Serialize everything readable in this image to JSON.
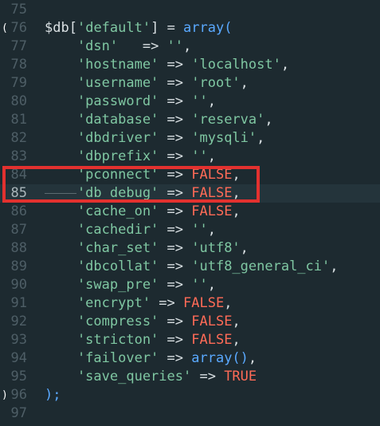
{
  "lines": [
    {
      "n": "75",
      "parts": []
    },
    {
      "n": "76",
      "fold": "(",
      "parts": [
        {
          "cls": "var",
          "t": "$db"
        },
        {
          "cls": "p",
          "t": "["
        },
        {
          "cls": "k",
          "t": "'default'"
        },
        {
          "cls": "p",
          "t": "] = "
        },
        {
          "cls": "fn",
          "t": "array("
        }
      ]
    },
    {
      "n": "77",
      "parts": [
        {
          "cls": "k",
          "t": "    'dsn'"
        },
        {
          "cls": "p",
          "t": "   => "
        },
        {
          "cls": "v",
          "t": "''"
        },
        {
          "cls": "p",
          "t": ","
        }
      ]
    },
    {
      "n": "78",
      "parts": [
        {
          "cls": "k",
          "t": "    'hostname'"
        },
        {
          "cls": "p",
          "t": " => "
        },
        {
          "cls": "v",
          "t": "'localhost'"
        },
        {
          "cls": "p",
          "t": ","
        }
      ]
    },
    {
      "n": "79",
      "parts": [
        {
          "cls": "k",
          "t": "    'username'"
        },
        {
          "cls": "p",
          "t": " => "
        },
        {
          "cls": "v",
          "t": "'root'"
        },
        {
          "cls": "p",
          "t": ","
        }
      ]
    },
    {
      "n": "80",
      "parts": [
        {
          "cls": "k",
          "t": "    'password'"
        },
        {
          "cls": "p",
          "t": " => "
        },
        {
          "cls": "v",
          "t": "''"
        },
        {
          "cls": "p",
          "t": ","
        }
      ]
    },
    {
      "n": "81",
      "parts": [
        {
          "cls": "k",
          "t": "    'database'"
        },
        {
          "cls": "p",
          "t": " => "
        },
        {
          "cls": "v",
          "t": "'reserva'"
        },
        {
          "cls": "p",
          "t": ","
        }
      ]
    },
    {
      "n": "82",
      "parts": [
        {
          "cls": "k",
          "t": "    'dbdriver'"
        },
        {
          "cls": "p",
          "t": " => "
        },
        {
          "cls": "v",
          "t": "'mysqli'"
        },
        {
          "cls": "p",
          "t": ","
        }
      ]
    },
    {
      "n": "83",
      "parts": [
        {
          "cls": "k",
          "t": "    'dbprefix'"
        },
        {
          "cls": "p",
          "t": " => "
        },
        {
          "cls": "v",
          "t": "''"
        },
        {
          "cls": "p",
          "t": ","
        }
      ]
    },
    {
      "n": "84",
      "parts": [
        {
          "cls": "k",
          "t": "    'pconnect'"
        },
        {
          "cls": "p",
          "t": " => "
        },
        {
          "cls": "c",
          "t": "FALSE"
        },
        {
          "cls": "p",
          "t": ","
        }
      ]
    },
    {
      "n": "85",
      "active": true,
      "guide": true,
      "parts": [
        {
          "cls": "k",
          "t": "    'db_debug'"
        },
        {
          "cls": "p",
          "t": " => "
        },
        {
          "cls": "c",
          "t": "FALSE"
        },
        {
          "cls": "p",
          "t": ","
        }
      ]
    },
    {
      "n": "86",
      "parts": [
        {
          "cls": "k",
          "t": "    'cache_on'"
        },
        {
          "cls": "p",
          "t": " => "
        },
        {
          "cls": "c",
          "t": "FALSE"
        },
        {
          "cls": "p",
          "t": ","
        }
      ]
    },
    {
      "n": "87",
      "parts": [
        {
          "cls": "k",
          "t": "    'cachedir'"
        },
        {
          "cls": "p",
          "t": " => "
        },
        {
          "cls": "v",
          "t": "''"
        },
        {
          "cls": "p",
          "t": ","
        }
      ]
    },
    {
      "n": "88",
      "parts": [
        {
          "cls": "k",
          "t": "    'char_set'"
        },
        {
          "cls": "p",
          "t": " => "
        },
        {
          "cls": "v",
          "t": "'utf8'"
        },
        {
          "cls": "p",
          "t": ","
        }
      ]
    },
    {
      "n": "89",
      "parts": [
        {
          "cls": "k",
          "t": "    'dbcollat'"
        },
        {
          "cls": "p",
          "t": " => "
        },
        {
          "cls": "v",
          "t": "'utf8_general_ci'"
        },
        {
          "cls": "p",
          "t": ","
        }
      ]
    },
    {
      "n": "90",
      "parts": [
        {
          "cls": "k",
          "t": "    'swap_pre'"
        },
        {
          "cls": "p",
          "t": " => "
        },
        {
          "cls": "v",
          "t": "''"
        },
        {
          "cls": "p",
          "t": ","
        }
      ]
    },
    {
      "n": "91",
      "parts": [
        {
          "cls": "k",
          "t": "    'encrypt'"
        },
        {
          "cls": "p",
          "t": " => "
        },
        {
          "cls": "c",
          "t": "FALSE"
        },
        {
          "cls": "p",
          "t": ","
        }
      ]
    },
    {
      "n": "92",
      "parts": [
        {
          "cls": "k",
          "t": "    'compress'"
        },
        {
          "cls": "p",
          "t": " => "
        },
        {
          "cls": "c",
          "t": "FALSE"
        },
        {
          "cls": "p",
          "t": ","
        }
      ]
    },
    {
      "n": "93",
      "parts": [
        {
          "cls": "k",
          "t": "    'stricton'"
        },
        {
          "cls": "p",
          "t": " => "
        },
        {
          "cls": "c",
          "t": "FALSE"
        },
        {
          "cls": "p",
          "t": ","
        }
      ]
    },
    {
      "n": "94",
      "parts": [
        {
          "cls": "k",
          "t": "    'failover'"
        },
        {
          "cls": "p",
          "t": " => "
        },
        {
          "cls": "fn",
          "t": "array()"
        },
        {
          "cls": "p",
          "t": ","
        }
      ]
    },
    {
      "n": "95",
      "parts": [
        {
          "cls": "k",
          "t": "    'save_queries'"
        },
        {
          "cls": "p",
          "t": " => "
        },
        {
          "cls": "c",
          "t": "TRUE"
        }
      ]
    },
    {
      "n": "96",
      "fold": ")",
      "parts": [
        {
          "cls": "fn",
          "t": ");"
        }
      ]
    },
    {
      "n": "97",
      "parts": []
    }
  ],
  "colors": {
    "background": "#1d2a30",
    "active_line": "#24343b",
    "highlight_box": "#e3312f"
  }
}
